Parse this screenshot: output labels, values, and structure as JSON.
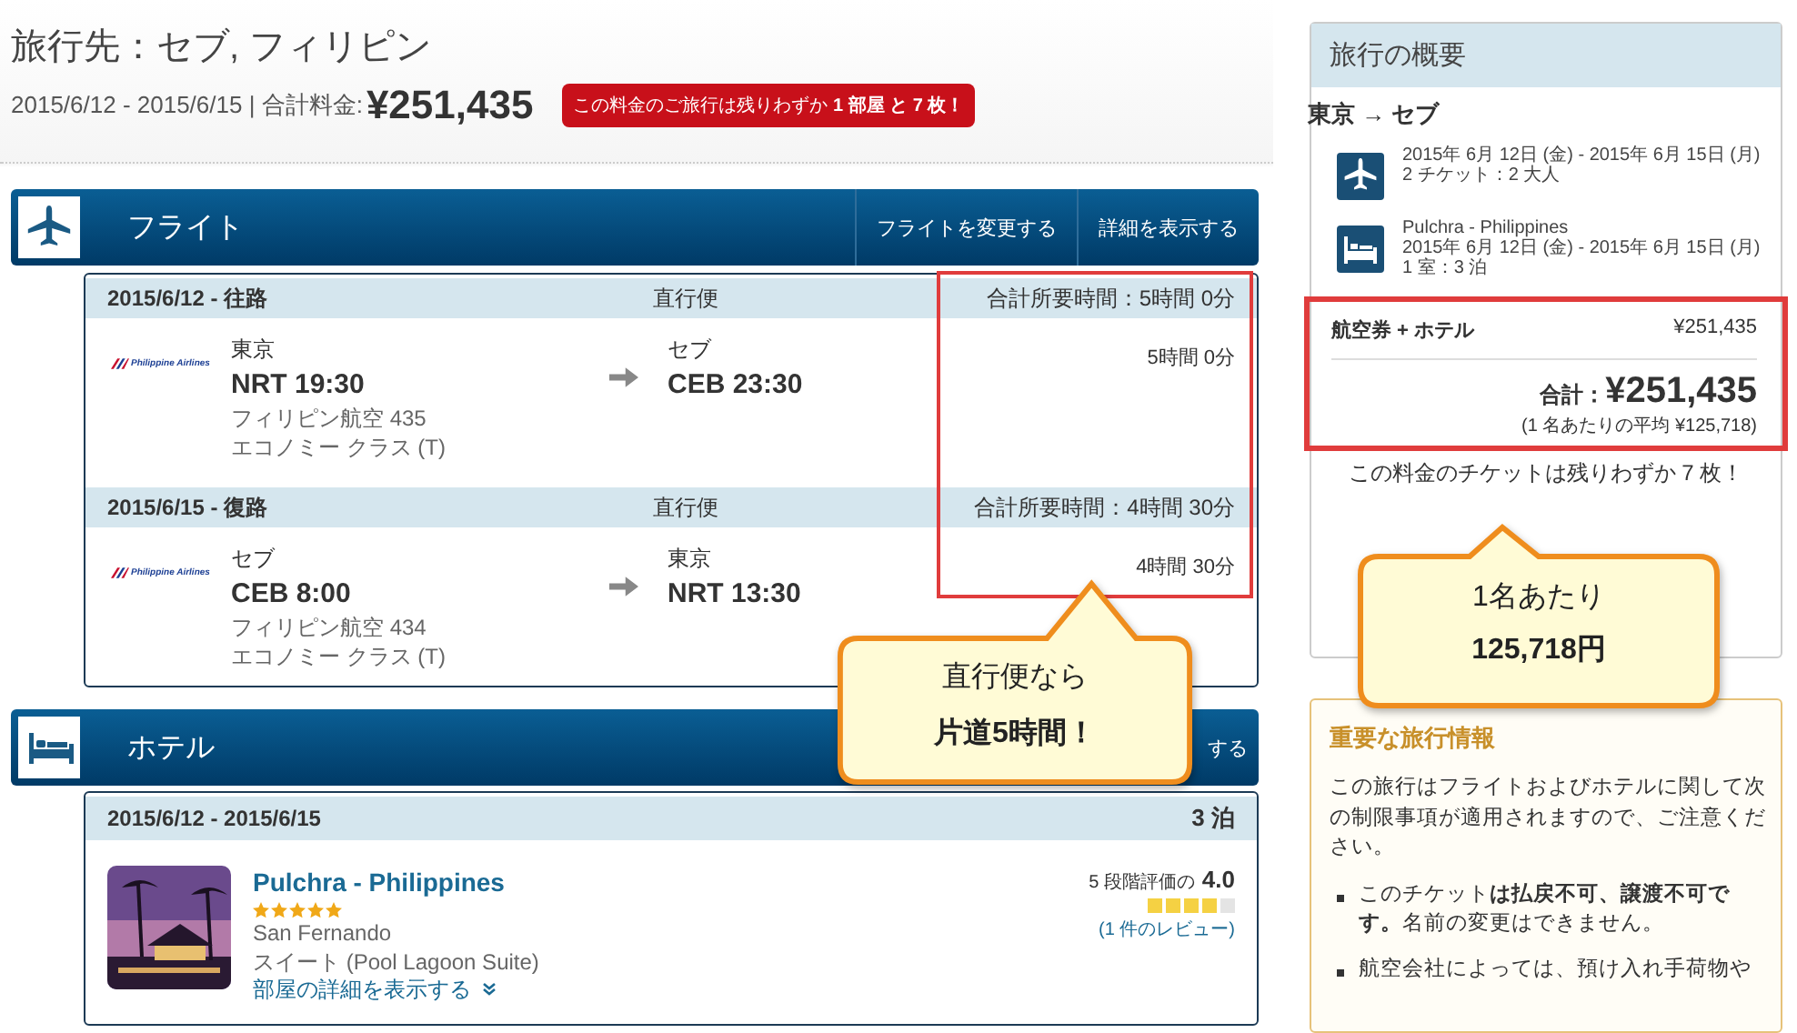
{
  "trip": {
    "title": "旅行先：セブ, フィリピン",
    "dates": "2015/6/12 - 2015/6/15 | 合計料金:",
    "total": "¥251,435",
    "alert": "この料金のご旅行は残りわずか **1 部屋 と 7 枚！**"
  },
  "flights": {
    "title": "フライト",
    "buttons": [
      "フライトを変更する",
      "詳細を表示する"
    ],
    "legs": [
      {
        "date": "2015/6/12 - 往路",
        "type": "直行便",
        "total_time": "合計所要時間：5時間 0分",
        "logo_text": "Philippine Airlines",
        "depart_city": "東京",
        "depart": "NRT 19:30",
        "airline": "フィリピン航空 435",
        "cabin": "エコノミー クラス (T)",
        "arrive_city": "セブ",
        "arrive": "CEB 23:30",
        "duration": "5時間 0分"
      },
      {
        "date": "2015/6/15 - 復路",
        "type": "直行便",
        "total_time": "合計所要時間：4時間 30分",
        "logo_text": "Philippine Airlines",
        "depart_city": "セブ",
        "depart": "CEB 8:00",
        "airline": "フィリピン航空 434",
        "cabin": "エコノミー クラス (T)",
        "arrive_city": "東京",
        "arrive": "NRT 13:30",
        "duration": "4時間 30分"
      }
    ]
  },
  "hotel": {
    "title": "ホテル",
    "button": "する",
    "dates": "2015/6/12 - 2015/6/15",
    "nights": "3 泊",
    "name": "Pulchra - Philippines",
    "stars": 5,
    "location": "San Fernando",
    "room": "スイート (Pool Lagoon Suite)",
    "details_link": "部屋の詳細を表示する",
    "review": {
      "label": "5 段階評価の",
      "score": "4.0",
      "stars": 4,
      "link": "(1 件のレビュー)"
    }
  },
  "summary": {
    "title": "旅行の概要",
    "route": "東京 → セブ",
    "items": [
      {
        "kind": "flight",
        "lines": [
          "2015年 6月 12日 (金) - 2015年 6月 15日 (月)",
          "2 チケット：2 大人"
        ]
      },
      {
        "kind": "hotel",
        "lines": [
          "Pulchra - Philippines",
          "2015年 6月 12日 (金) - 2015年 6月 15日 (月)",
          "1 室：3 泊"
        ]
      }
    ],
    "price_label": "航空券 + ホテル",
    "price": "¥251,435",
    "total_label": "合計：",
    "total": "¥251,435",
    "average": "(1 名あたりの平均 ¥125,718)",
    "notice": "この料金のチケットは残りわずか 7 枚！"
  },
  "info": {
    "title": "重要な旅行情報",
    "text": "この旅行はフライトおよびホテルに関して次の制限事項が適用されますので、ご注意ください。",
    "bullets": [
      "このチケット**は払戻不可、譲渡不可です。**名前の変更はできません。",
      "航空会社によっては、預け入れ手荷物や"
    ]
  },
  "callouts": [
    {
      "lines": [
        "直行便なら",
        "片道5時間！"
      ]
    },
    {
      "lines": [
        "1名あたり",
        "125,718円"
      ]
    }
  ]
}
